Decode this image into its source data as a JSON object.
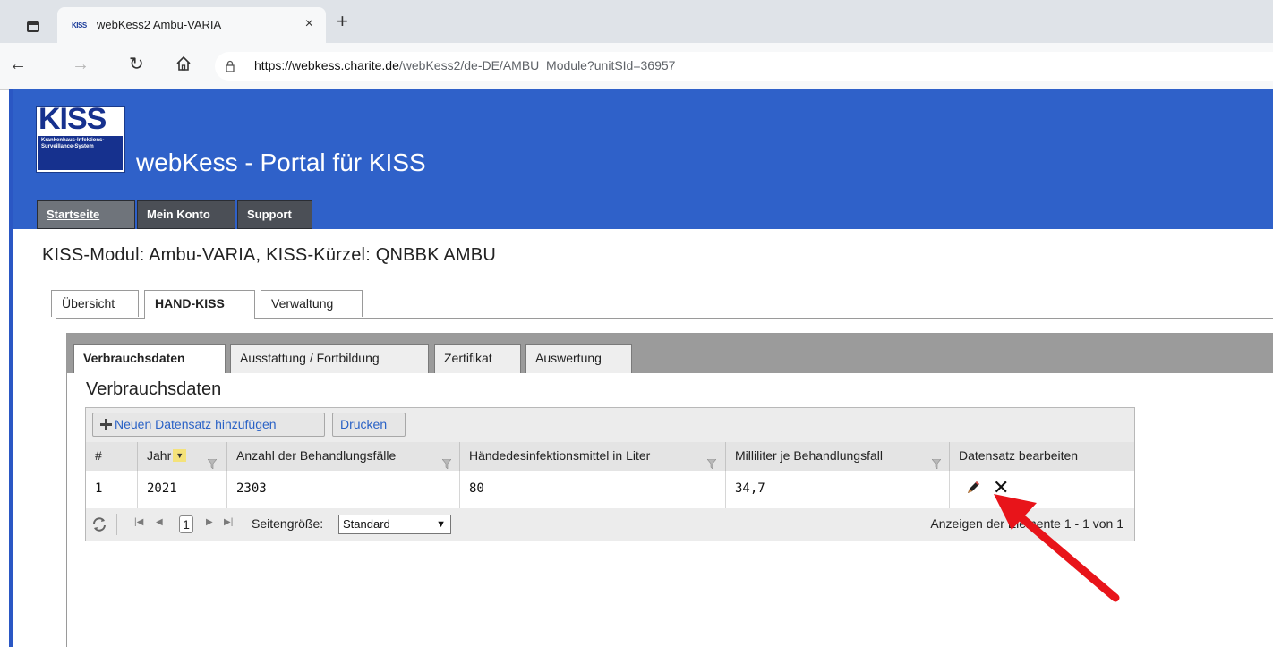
{
  "browser": {
    "tab_title": "webKess2 Ambu-VARIA",
    "tab_favicon": "KISS",
    "close": "×",
    "new_tab": "+",
    "url_host": "https://webkess.charite.de",
    "url_path": "/webKess2/de-DE/AMBU_Module?unitSId=36957"
  },
  "header": {
    "logo_text": "KISS",
    "logo_subtext": "Krankenhaus-Infektions-Surveillance-System",
    "site_title": "webKess - Portal für KISS",
    "nav": [
      {
        "label": "Startseite",
        "active": true
      },
      {
        "label": "Mein Konto",
        "active": false
      },
      {
        "label": "Support",
        "active": false
      }
    ]
  },
  "module_title": "KISS-Modul: Ambu-VARIA, KISS-Kürzel: QNBBK AMBU",
  "outer_tabs": [
    "Übersicht",
    "HAND-KISS",
    "Verwaltung"
  ],
  "inner_tabs": [
    "Verbrauchsdaten",
    "Ausstattung / Fortbildung",
    "Zertifikat",
    "Auswertung"
  ],
  "section_title": "Verbrauchsdaten",
  "toolbar": {
    "add_label": "Neuen Datensatz hinzufügen",
    "print_label": "Drucken"
  },
  "table": {
    "columns": [
      "#",
      "Jahr",
      "Anzahl der Behandlungsfälle",
      "Händedesinfektionsmittel in Liter",
      "Milliliter je Behandlungsfall",
      "Datensatz bearbeiten"
    ],
    "rows": [
      [
        "1",
        "2021",
        "2303",
        "80",
        "34,7"
      ]
    ]
  },
  "pager": {
    "current_page": "1",
    "page_size_label": "Seitengröße:",
    "page_size_value": "Standard",
    "info": "Anzeigen der Elemente 1 - 1 von 1"
  },
  "colors": {
    "header_blue": "#2f61c9",
    "link_blue": "#2a62c6",
    "arrow_red": "#e8141a"
  }
}
